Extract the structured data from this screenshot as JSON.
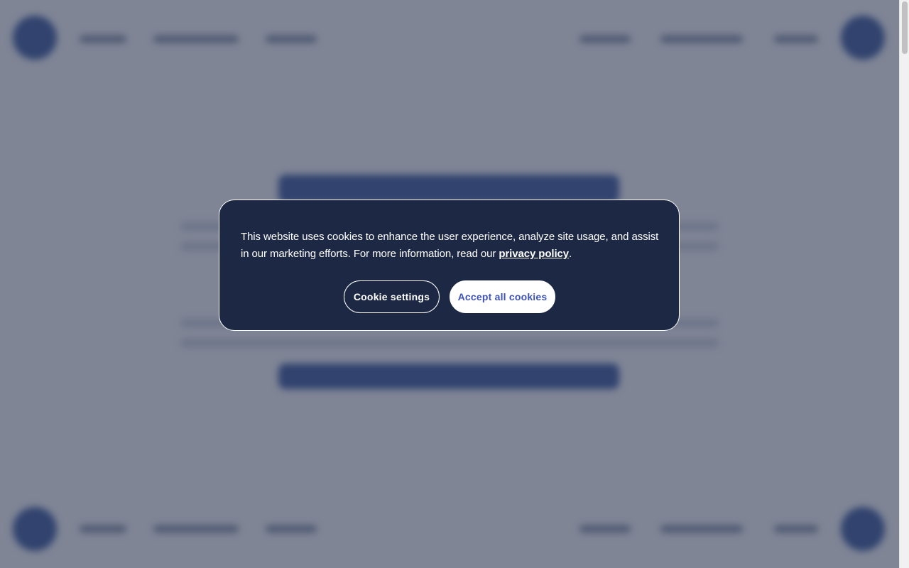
{
  "cookie_banner": {
    "message_prefix": "This website uses cookies to enhance the user experience, analyze site usage, and assist in our marketing efforts. For more information, read our ",
    "privacy_link": "privacy policy",
    "message_suffix": ".",
    "settings_button": "Cookie settings",
    "accept_button": "Accept all cookies"
  },
  "colors": {
    "dialog_background": "#1d2944",
    "accept_text": "#3d52b8",
    "overlay": "#3e465c"
  }
}
